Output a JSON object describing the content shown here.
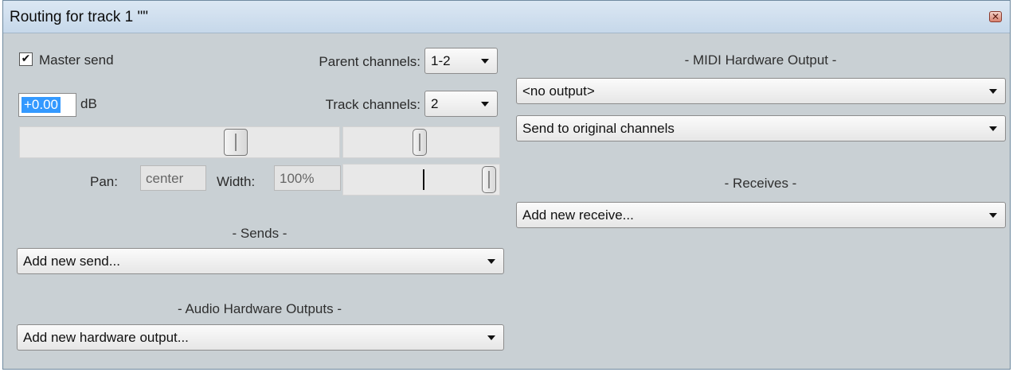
{
  "window": {
    "title": "Routing for track 1 \"\"",
    "close_icon": "close-icon"
  },
  "master_send": {
    "label": "Master send",
    "checked": true,
    "check_glyph": "✔"
  },
  "parent_channels": {
    "label": "Parent channels:",
    "value": "1-2"
  },
  "track_channels": {
    "label": "Track channels:",
    "value": "2"
  },
  "volume": {
    "value": "+0.00",
    "unit": "dB"
  },
  "pan": {
    "label": "Pan:",
    "value": "center"
  },
  "width": {
    "label": "Width:",
    "value": "100%"
  },
  "sends": {
    "heading": "- Sends -",
    "select": "Add new send..."
  },
  "audio_hw": {
    "heading": "- Audio Hardware Outputs -",
    "select": "Add new hardware output..."
  },
  "midi_hw": {
    "heading": "- MIDI Hardware Output -",
    "output_select": "<no output>",
    "channel_select": "Send to original channels"
  },
  "receives": {
    "heading": "- Receives -",
    "select": "Add new receive..."
  },
  "colors": {
    "window_bg": "#c9d0d4",
    "titlebar": "#c6d8ea",
    "selection": "#3399ff"
  }
}
